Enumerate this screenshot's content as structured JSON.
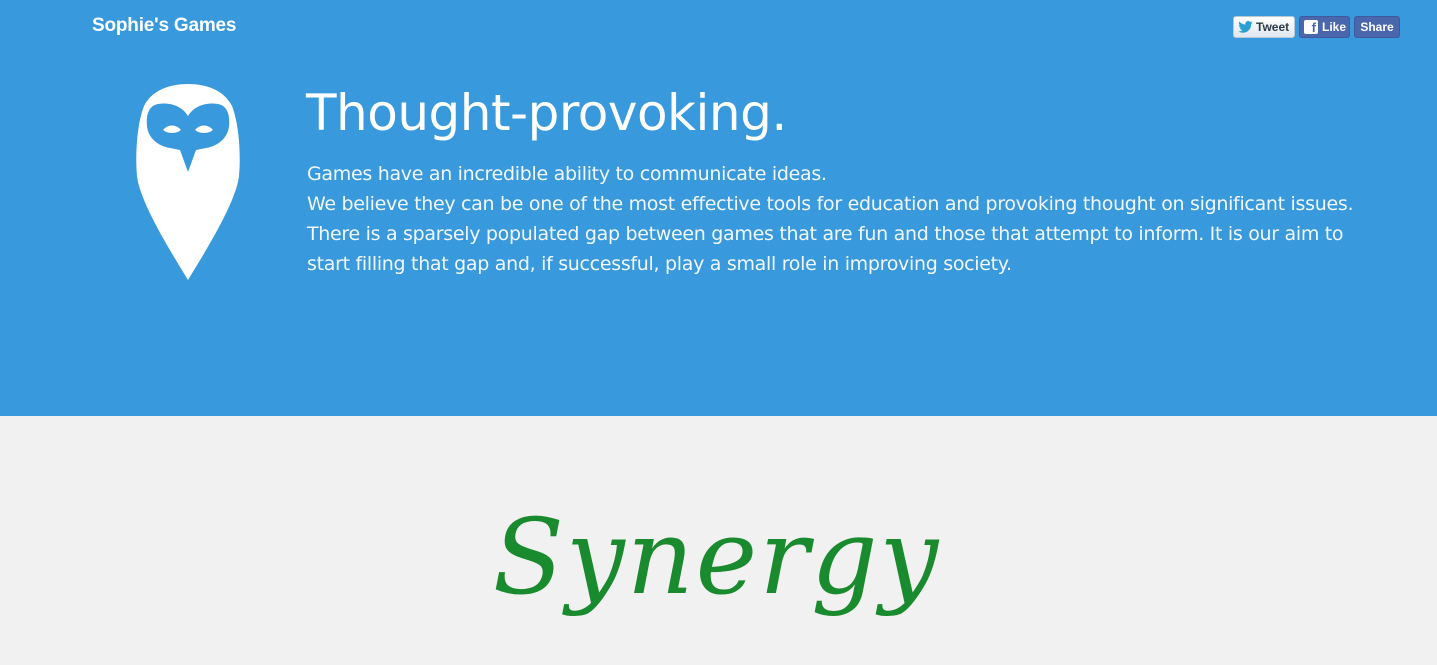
{
  "brand": {
    "name": "Sophie's Games"
  },
  "social": {
    "tweet_label": "Tweet",
    "like_label": "Like",
    "share_label": "Share"
  },
  "hero": {
    "headline": "Thought-provoking.",
    "paragraphs": [
      "Games have an incredible ability to communicate ideas.",
      "We believe they can be one of the most effective tools for education and provoking thought on significant issues.",
      "There is a sparsely populated gap between games that are fun and those that attempt to inform. It is our aim to start filling that gap and, if successful, play a small role in improving society."
    ]
  },
  "game": {
    "title": "Synergy"
  },
  "icons": {
    "owl_logo": "owl-logo-icon",
    "twitter": "twitter-bird-icon",
    "facebook": "facebook-f-icon"
  },
  "colors": {
    "hero_background": "#3899dc",
    "lower_background": "#f1f1f1",
    "game_title": "#1a8a2e",
    "facebook": "#4a66ad"
  }
}
